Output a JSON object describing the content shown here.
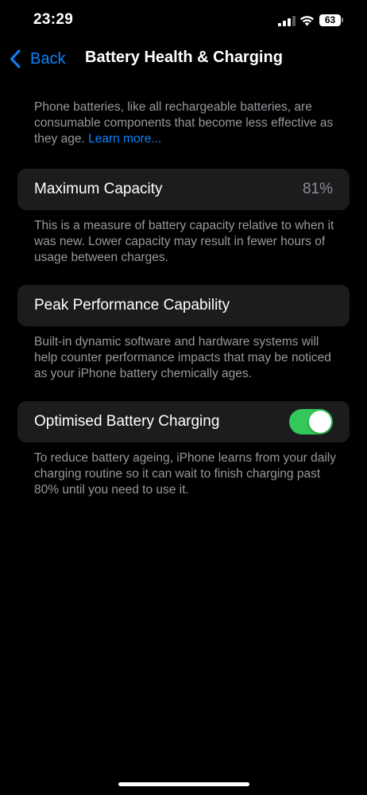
{
  "status_bar": {
    "time": "23:29",
    "battery_level": "63",
    "signal_icon": "cellular-signal-icon",
    "wifi_icon": "wifi-icon",
    "signal_bars_active": 3,
    "signal_bars_total": 4
  },
  "nav": {
    "back_label": "Back",
    "back_icon": "chevron-left-icon",
    "title": "Battery Health & Charging"
  },
  "intro": {
    "text": "Phone batteries, like all rechargeable batteries, are consumable components that become less effective as they age. ",
    "link": "Learn more..."
  },
  "max_capacity": {
    "label": "Maximum Capacity",
    "value": "81%",
    "footer": "This is a measure of battery capacity relative to when it was new. Lower capacity may result in fewer hours of usage between charges."
  },
  "peak_performance": {
    "label": "Peak Performance Capability",
    "footer": "Built-in dynamic software and hardware systems will help counter performance impacts that may be noticed as your iPhone battery chemically ages."
  },
  "optimised_charging": {
    "label": "Optimised Battery Charging",
    "enabled": true,
    "footer": "To reduce battery ageing, iPhone learns from your daily charging routine so it can wait to finish charging past 80% until you need to use it."
  },
  "colors": {
    "background": "#000000",
    "cell_background": "#1c1c1e",
    "accent_blue": "#0a84ff",
    "toggle_on": "#34c759",
    "secondary_text": "#98989f",
    "signal_active": "#ffffff",
    "signal_inactive": "#5a5a5e"
  }
}
